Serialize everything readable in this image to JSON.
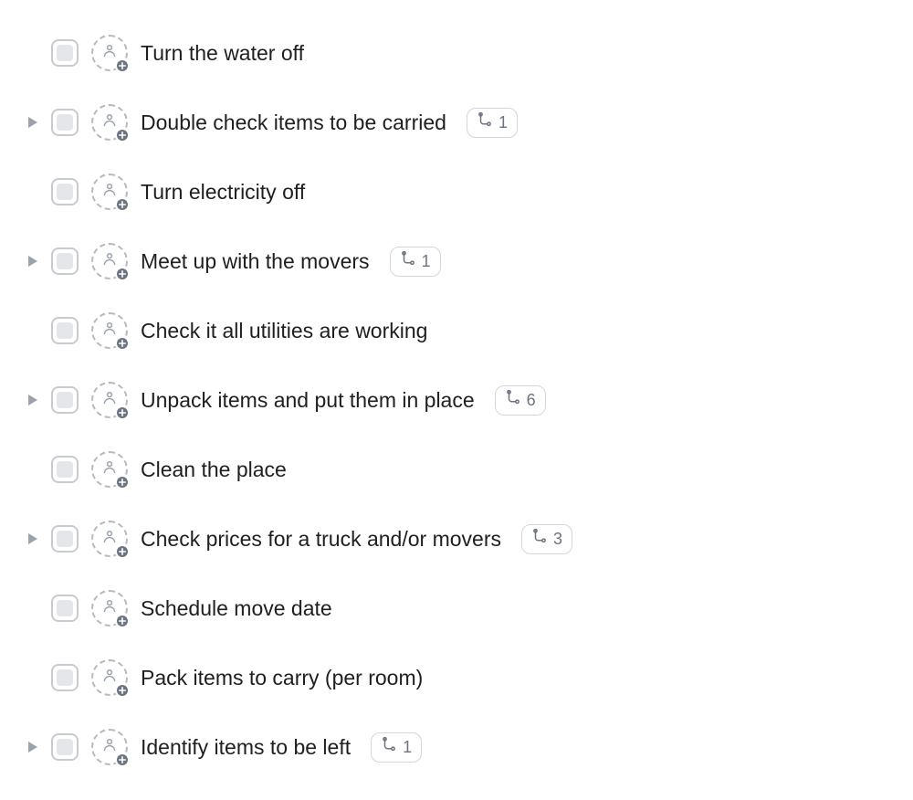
{
  "tasks": [
    {
      "title": "Turn the water off",
      "hasSubtasks": false,
      "subtaskCount": null
    },
    {
      "title": "Double check items to be carried",
      "hasSubtasks": true,
      "subtaskCount": "1"
    },
    {
      "title": "Turn electricity off",
      "hasSubtasks": false,
      "subtaskCount": null
    },
    {
      "title": "Meet up with the movers",
      "hasSubtasks": true,
      "subtaskCount": "1"
    },
    {
      "title": "Check it all utilities are working",
      "hasSubtasks": false,
      "subtaskCount": null
    },
    {
      "title": "Unpack items and put them in place",
      "hasSubtasks": true,
      "subtaskCount": "6"
    },
    {
      "title": "Clean the place",
      "hasSubtasks": false,
      "subtaskCount": null
    },
    {
      "title": "Check prices for a truck and/or movers",
      "hasSubtasks": true,
      "subtaskCount": "3"
    },
    {
      "title": "Schedule move date",
      "hasSubtasks": false,
      "subtaskCount": null
    },
    {
      "title": "Pack items to carry (per room)",
      "hasSubtasks": false,
      "subtaskCount": null
    },
    {
      "title": "Identify items to be left",
      "hasSubtasks": true,
      "subtaskCount": "1"
    }
  ]
}
